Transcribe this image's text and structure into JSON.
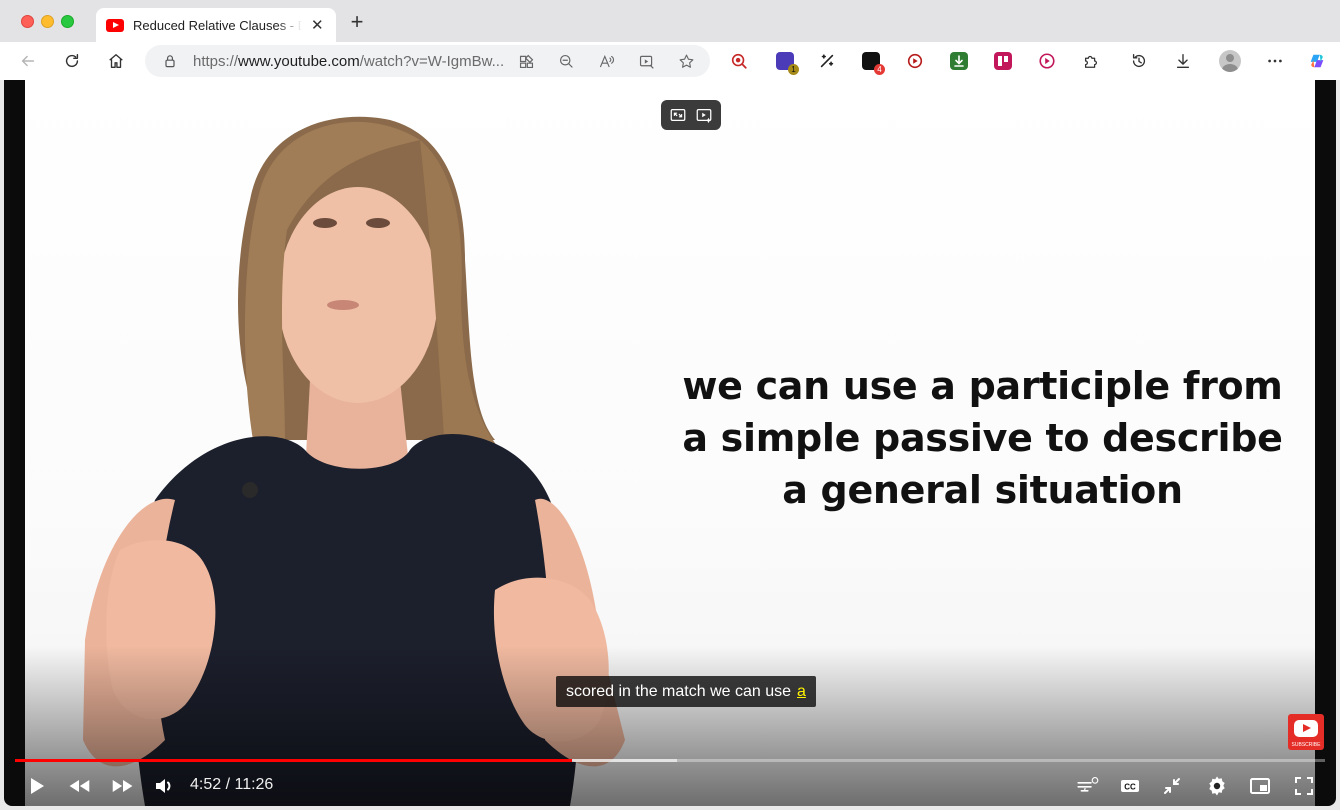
{
  "browser": {
    "tab": {
      "title": "Reduced Relative Clauses - De"
    },
    "address": {
      "prefix": "https://",
      "domain": "www.youtube.com",
      "path": "/watch?v=W-IgmBw..."
    },
    "extension_badges": {
      "purple_ext": "1",
      "black_ext": "4"
    }
  },
  "video": {
    "slide_lines": [
      "we can use a participle from",
      "a simple passive to describe",
      "a general situation"
    ],
    "caption": {
      "text": "scored in the match we can use",
      "highlight": "a"
    },
    "subscribe_label": "SUBSCRIBE",
    "info_glyph": "i",
    "player": {
      "current_time": "4:52",
      "duration": "11:26",
      "time_display": "4:52 / 11:26",
      "played_fraction": 0.425,
      "buffered_fraction": 0.505
    }
  },
  "colors": {
    "progress_played": "#ff0000",
    "youtube_red": "#ff0000",
    "caption_highlight": "#fff200"
  }
}
